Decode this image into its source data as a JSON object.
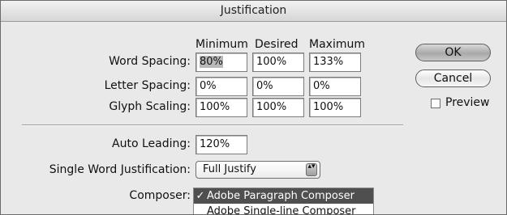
{
  "dialog": {
    "title": "Justification",
    "columns": [
      "Minimum",
      "Desired",
      "Maximum"
    ],
    "rows": [
      {
        "label": "Word Spacing:",
        "values": [
          "80%",
          "100%",
          "133%"
        ]
      },
      {
        "label": "Letter Spacing:",
        "values": [
          "0%",
          "0%",
          "0%"
        ]
      },
      {
        "label": "Glyph Scaling:",
        "values": [
          "100%",
          "100%",
          "100%"
        ]
      }
    ],
    "auto_leading": {
      "label": "Auto Leading:",
      "value": "120%"
    },
    "single_word": {
      "label": "Single Word Justification:",
      "value": "Full Justify",
      "arrows": "▴▾"
    },
    "composer": {
      "label": "Composer:",
      "check_mark": "✓",
      "options": [
        "Adobe Paragraph Composer",
        "Adobe Single-line Composer"
      ],
      "selected_index": 0
    },
    "buttons": {
      "ok": "OK",
      "cancel": "Cancel"
    },
    "preview": {
      "label": "Preview",
      "checked": false
    }
  }
}
